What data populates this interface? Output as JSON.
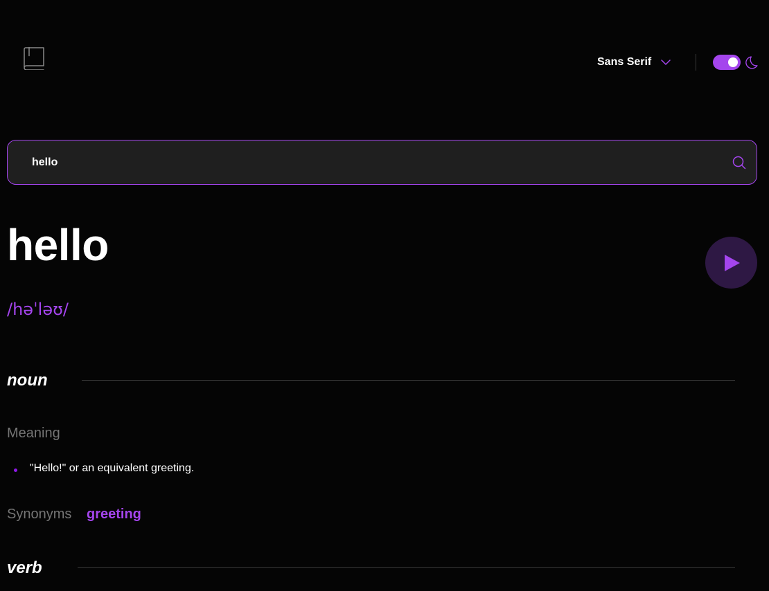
{
  "header": {
    "logo_icon": "book-icon",
    "font_selector": {
      "label": "Sans Serif",
      "icon": "chevron-down-icon"
    },
    "theme_toggle": {
      "state": "dark",
      "icon": "moon-icon"
    }
  },
  "search": {
    "value": "hello",
    "placeholder": "",
    "icon": "search-icon"
  },
  "entry": {
    "word": "hello",
    "phonetic": "/həˈləʊ/",
    "play_icon": "play-icon"
  },
  "meanings": [
    {
      "part_of_speech": "noun",
      "meaning_label": "Meaning",
      "definitions": [
        "\"Hello!\" or an equivalent greeting."
      ],
      "synonyms_label": "Synonyms",
      "synonyms": [
        "greeting"
      ]
    },
    {
      "part_of_speech": "verb"
    }
  ],
  "colors": {
    "background": "#050505",
    "accent": "#a445ed",
    "muted": "#757575",
    "search_bg": "#1f1f1f",
    "play_bg": "#2e1844"
  }
}
